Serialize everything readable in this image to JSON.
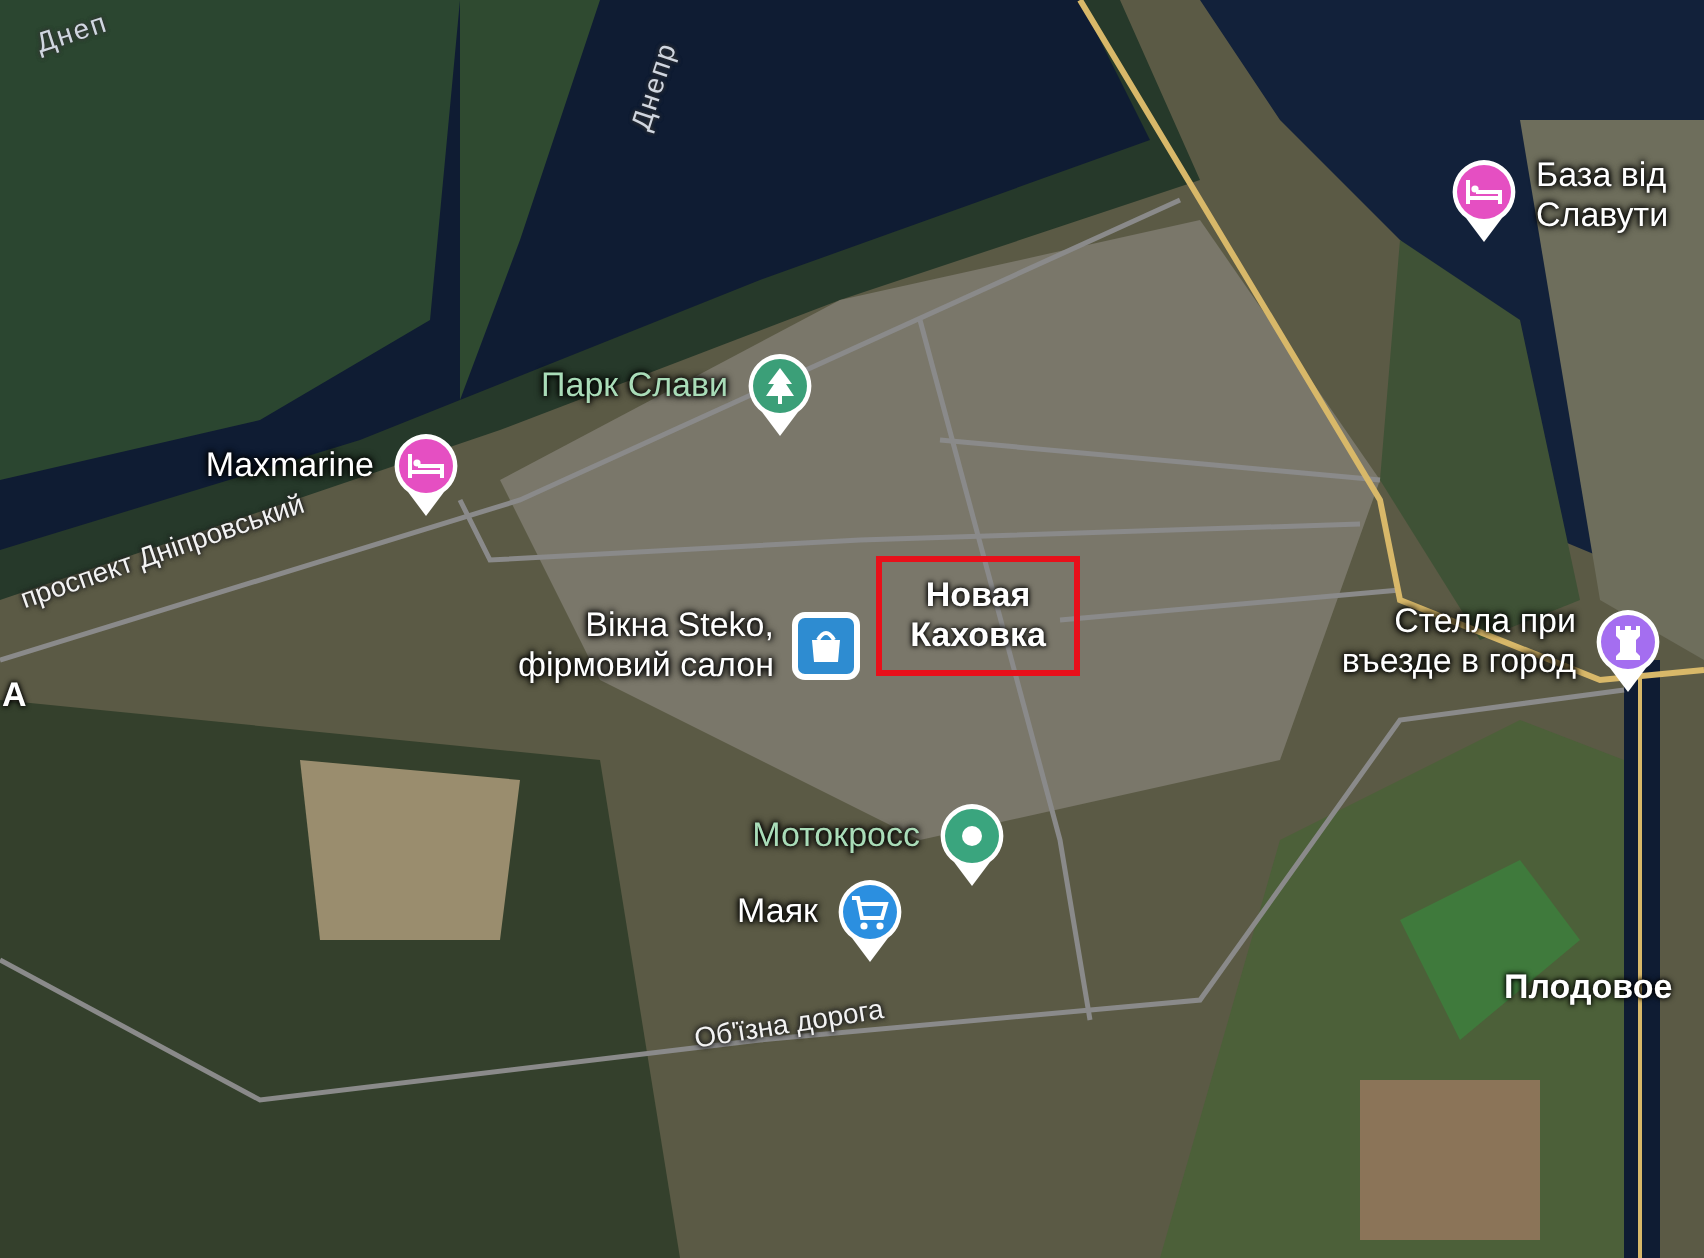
{
  "map": {
    "water_labels": [
      {
        "text": "Днеп"
      },
      {
        "text": "Днепр"
      }
    ],
    "road_labels": [
      {
        "text": "проспект Дніпровський"
      },
      {
        "text": "Об'їзна дорога"
      }
    ],
    "places": [
      {
        "kind": "hotel",
        "color": "#e54fc2",
        "label_lines": [
          "База від",
          "Славути"
        ]
      },
      {
        "kind": "park",
        "color": "#3b9f78",
        "label_lines": [
          "Парк Слави"
        ]
      },
      {
        "kind": "hotel",
        "color": "#e54fc2",
        "label_lines": [
          "Maxmarine"
        ]
      },
      {
        "kind": "shop",
        "color": "#2e8cd1",
        "label_lines": [
          "Вікна Steko,",
          "фірмовий салон"
        ]
      },
      {
        "kind": "monument",
        "color": "#a46ef0",
        "label_lines": [
          "Стелла при",
          "въезде в город"
        ]
      },
      {
        "kind": "spot",
        "color": "#3aa57e",
        "label_lines": [
          "Мотокросс"
        ]
      },
      {
        "kind": "cart",
        "color": "#2b8fe0",
        "label_lines": [
          "Маяк"
        ]
      }
    ],
    "settlements": [
      {
        "text": "Новая Каховка",
        "highlighted": true
      },
      {
        "text": "Плодовое",
        "highlighted": false
      },
      {
        "text": "А",
        "highlighted": false
      }
    ]
  }
}
